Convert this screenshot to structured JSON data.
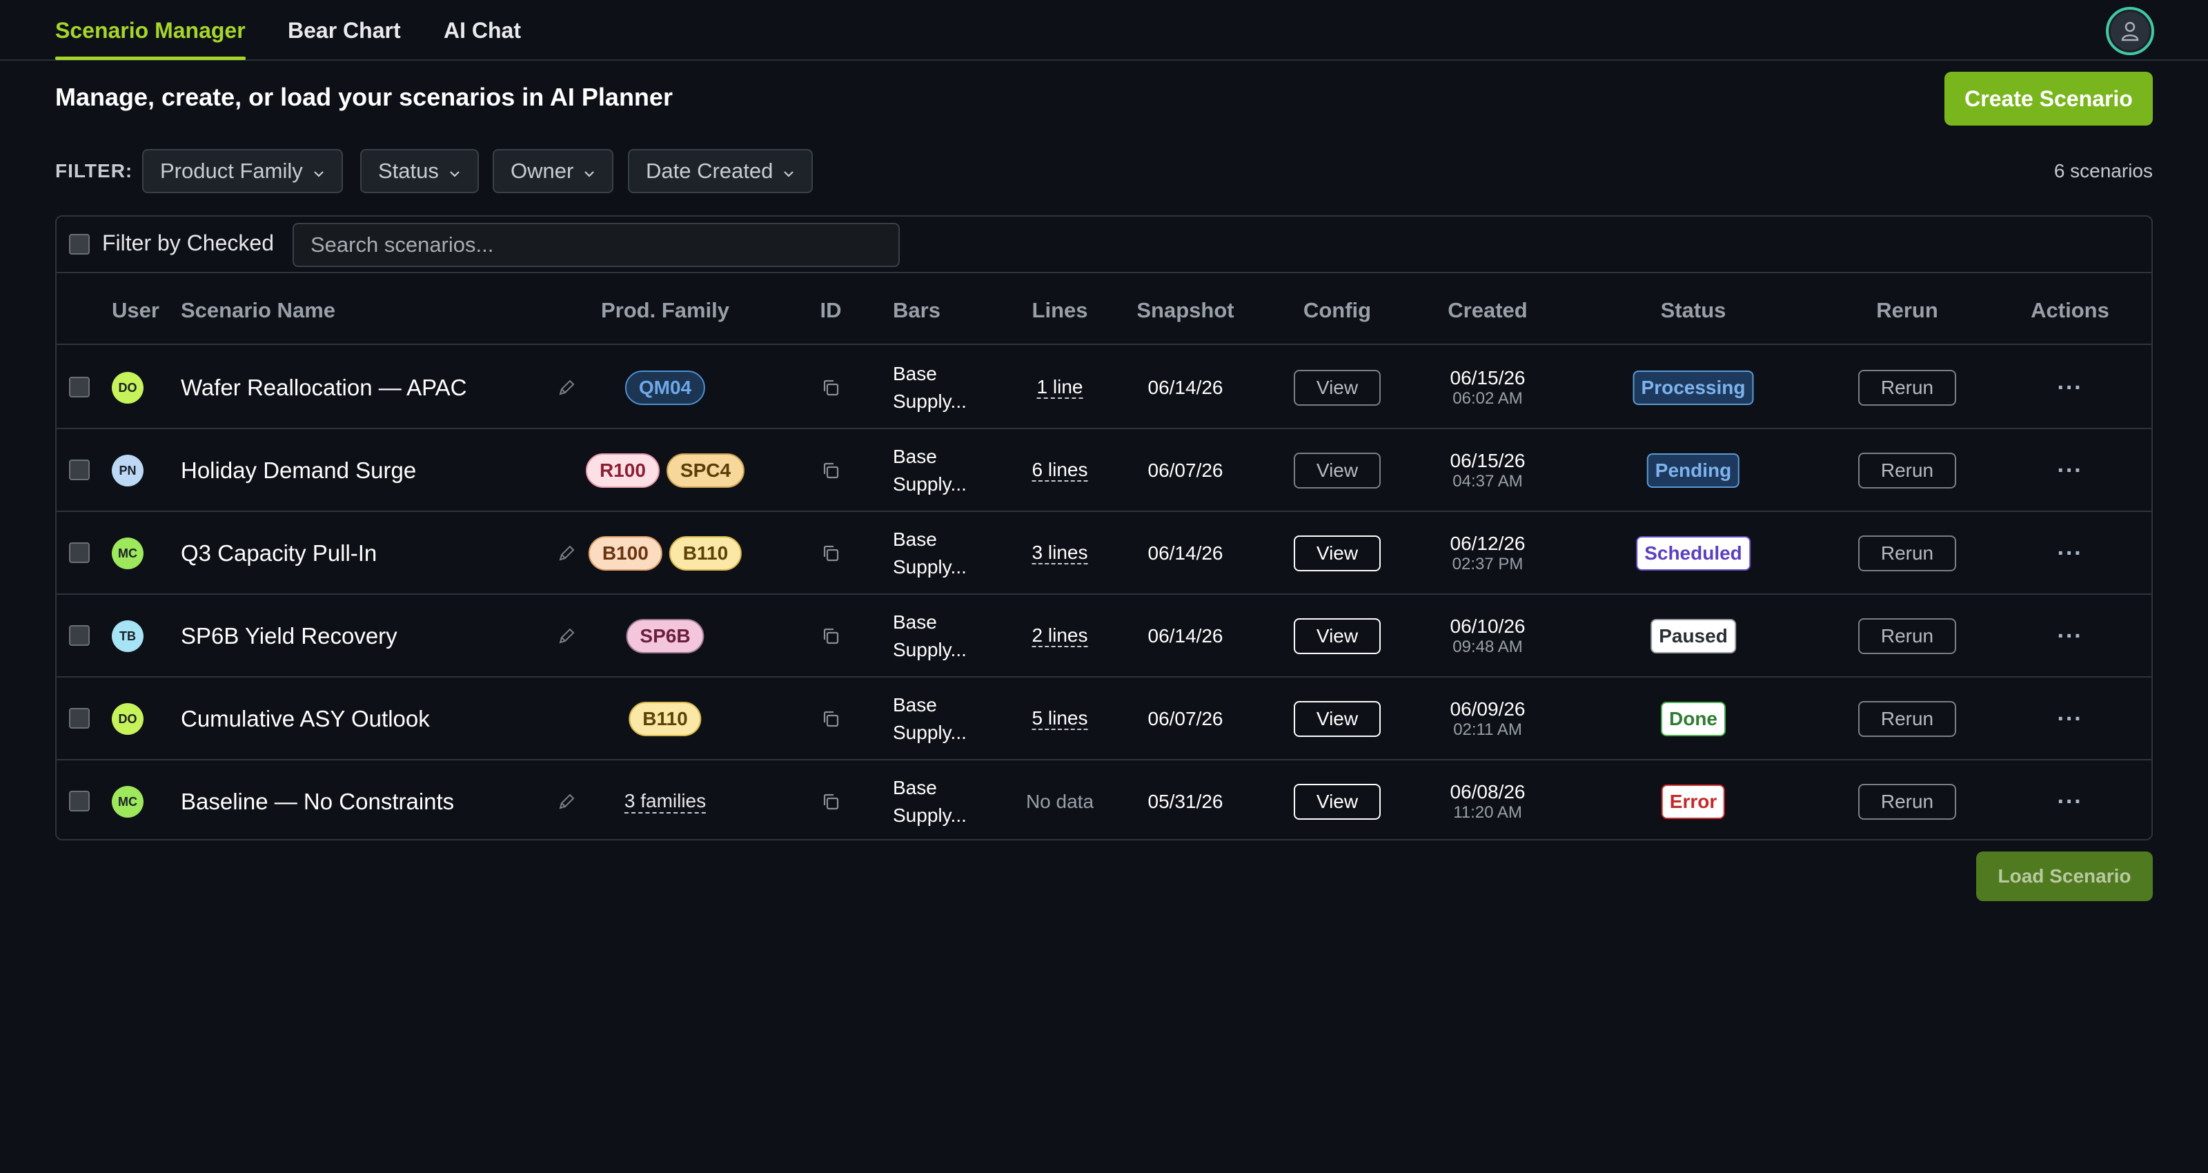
{
  "nav": {
    "tabs": [
      {
        "label": "Scenario Manager",
        "active": true
      },
      {
        "label": "Bear Chart",
        "active": false
      },
      {
        "label": "AI Chat",
        "active": false
      }
    ],
    "avatar_icon": "user-icon"
  },
  "header": {
    "title": "Manage, create, or load your scenarios in AI Planner",
    "create_label": "Create Scenario"
  },
  "filters": {
    "label": "FILTER:",
    "dropdowns": [
      "Product Family",
      "Status",
      "Owner",
      "Date Created"
    ],
    "count": "6 scenarios"
  },
  "toolbar": {
    "filter_checked_label": "Filter by Checked",
    "search_placeholder": "Search scenarios..."
  },
  "columns": [
    "User",
    "Scenario Name",
    "Prod. Family",
    "ID",
    "Bars",
    "Lines",
    "Snapshot",
    "Config",
    "Created",
    "Status",
    "Rerun",
    "Actions"
  ],
  "rows": [
    {
      "user": "DO",
      "user_color": "#c6f25a",
      "name": "Wafer Reallocation — APAC",
      "editable": true,
      "families": [
        {
          "label": "QM04",
          "bg": "#1b3552",
          "border": "#4e8fd1",
          "color": "#6fa8e8"
        }
      ],
      "families_text": "",
      "bars_l1": "Base",
      "bars_l2": "Supply...",
      "lines": "1 line",
      "snapshot": "06/14/26",
      "config": "View",
      "config_style": "muted",
      "created_date": "06/15/26",
      "created_time": "06:02 AM",
      "status": "Processing",
      "status_bg": "#1d3a5e",
      "status_border": "#5a9ad6",
      "status_color": "#7eb3ee",
      "rerun": "Rerun",
      "actions": "···"
    },
    {
      "user": "PN",
      "user_color": "#bcd8f5",
      "name": "Holiday Demand Surge",
      "editable": false,
      "families": [
        {
          "label": "R100",
          "bg": "#fde0e6",
          "border": "#e89aab",
          "color": "#8a1f34"
        },
        {
          "label": "SPC4",
          "bg": "#f7d79a",
          "border": "#c9a150",
          "color": "#5a3d08"
        }
      ],
      "families_text": "",
      "bars_l1": "Base",
      "bars_l2": "Supply...",
      "lines": "6 lines",
      "snapshot": "06/07/26",
      "config": "View",
      "config_style": "muted",
      "created_date": "06/15/26",
      "created_time": "04:37 AM",
      "status": "Pending",
      "status_bg": "#1d3a5e",
      "status_border": "#5a9ad6",
      "status_color": "#7eb3ee",
      "rerun": "Rerun",
      "actions": "···"
    },
    {
      "user": "MC",
      "user_color": "#9ee85c",
      "name": "Q3 Capacity Pull-In",
      "editable": true,
      "families": [
        {
          "label": "B100",
          "bg": "#fbdcc0",
          "border": "#e0a066",
          "color": "#6a3410"
        },
        {
          "label": "B110",
          "bg": "#fbe7a6",
          "border": "#d8b84a",
          "color": "#5c4408"
        }
      ],
      "families_text": "",
      "bars_l1": "Base",
      "bars_l2": "Supply...",
      "lines": "3 lines",
      "snapshot": "06/14/26",
      "config": "View",
      "config_style": "bright",
      "created_date": "06/12/26",
      "created_time": "02:37 PM",
      "status": "Scheduled",
      "status_bg": "#ffffff",
      "status_border": "#6a4fd0",
      "status_color": "#5a3fc0",
      "rerun": "Rerun",
      "actions": "···"
    },
    {
      "user": "TB",
      "user_color": "#a6e3f5",
      "name": "SP6B Yield Recovery",
      "editable": true,
      "families": [
        {
          "label": "SP6B",
          "bg": "#f4c6dc",
          "border": "#9a7890",
          "color": "#6a1f40"
        }
      ],
      "families_text": "",
      "bars_l1": "Base",
      "bars_l2": "Supply...",
      "lines": "2 lines",
      "snapshot": "06/14/26",
      "config": "View",
      "config_style": "bright",
      "created_date": "06/10/26",
      "created_time": "09:48 AM",
      "status": "Paused",
      "status_bg": "#ffffff",
      "status_border": "#9aa0a8",
      "status_color": "#2a2f36",
      "rerun": "Rerun",
      "actions": "···"
    },
    {
      "user": "DO",
      "user_color": "#c6f25a",
      "name": "Cumulative ASY Outlook",
      "editable": false,
      "families": [
        {
          "label": "B110",
          "bg": "#fbe7a6",
          "border": "#d8b84a",
          "color": "#5c4408"
        }
      ],
      "families_text": "",
      "bars_l1": "Base",
      "bars_l2": "Supply...",
      "lines": "5 lines",
      "snapshot": "06/07/26",
      "config": "View",
      "config_style": "bright",
      "created_date": "06/09/26",
      "created_time": "02:11 AM",
      "status": "Done",
      "status_bg": "#ffffff",
      "status_border": "#4caf50",
      "status_color": "#2e7d32",
      "rerun": "Rerun",
      "actions": "···"
    },
    {
      "user": "MC",
      "user_color": "#9ee85c",
      "name": "Baseline — No Constraints",
      "editable": true,
      "families": [],
      "families_text": "3 families",
      "bars_l1": "Base",
      "bars_l2": "Supply...",
      "lines": "",
      "lines_nodata": "No data",
      "snapshot": "05/31/26",
      "config": "View",
      "config_style": "bright",
      "created_date": "06/08/26",
      "created_time": "11:20 AM",
      "status": "Error",
      "status_bg": "#ffffff",
      "status_border": "#d32f2f",
      "status_color": "#c62828",
      "rerun": "Rerun",
      "actions": "···"
    }
  ],
  "footer": {
    "load_label": "Load Scenario"
  }
}
